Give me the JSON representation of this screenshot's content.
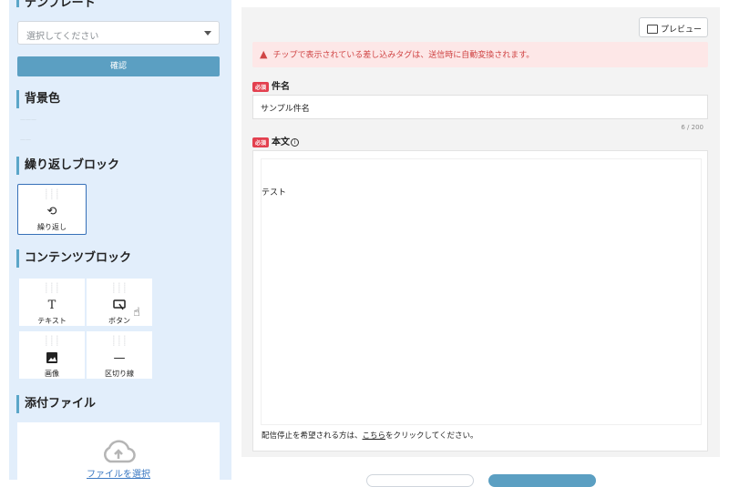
{
  "sidebar": {
    "cut_heading": "テンプレート",
    "select": {
      "placeholder": "選択してください"
    },
    "confirm_label": "確認",
    "bg_title": "背景色",
    "repeat_title": "繰り返しブロック",
    "repeat_block_label": "繰り返し",
    "contents_title": "コンテンツブロック",
    "blocks": [
      {
        "label": "テキスト",
        "icon": "text-icon"
      },
      {
        "label": "ボタン",
        "icon": "button-icon"
      },
      {
        "label": "画像",
        "icon": "image-icon"
      },
      {
        "label": "区切り線",
        "icon": "divider-icon"
      }
    ],
    "attach_title": "添付ファイル",
    "upload_link": "ファイルを選択"
  },
  "main": {
    "preview_label": "プレビュー",
    "alert_text": "チップで表示されている差し込みタグは、送信時に自動変換されます。",
    "required_badge": "必須",
    "subject_label": "件名",
    "subject_value": "サンプル件名",
    "subject_counter": "6 / 200",
    "body_label": "本文",
    "body_text": "テスト",
    "footer_prefix": "配信停止を希望される方は、",
    "footer_link": "こちら",
    "footer_suffix": "をクリックしてください。"
  },
  "colors": {
    "sidebar_bg": "#e2eefb",
    "accent": "#5b9fc2",
    "alert_bg": "#fde7e7",
    "alert_text": "#d04545",
    "required": "#e3404f",
    "selected_border": "#3670b8"
  }
}
